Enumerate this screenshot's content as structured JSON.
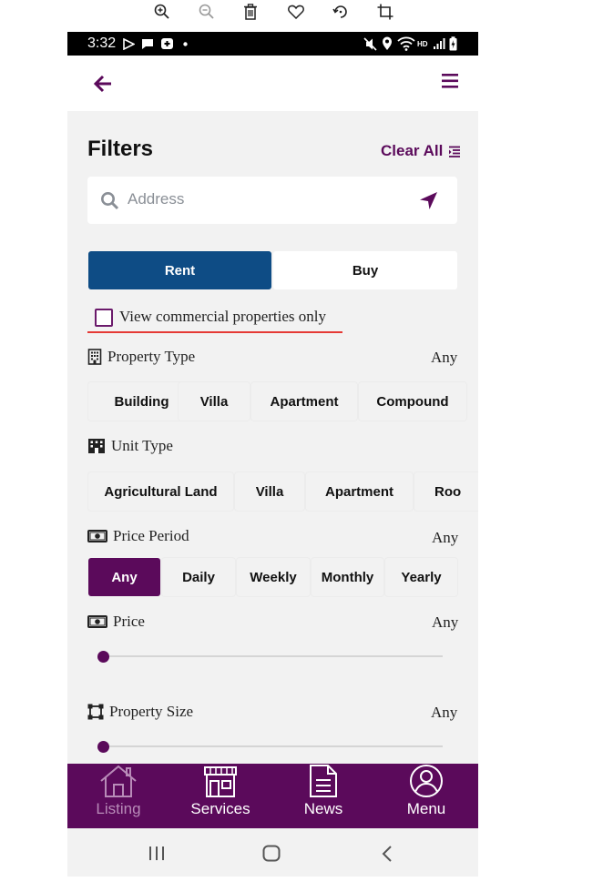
{
  "viewer_toolbar": {
    "icons": [
      "zoom-in-icon",
      "zoom-out-icon",
      "trash-icon",
      "heart-icon",
      "rotate-icon",
      "crop-icon"
    ]
  },
  "status_bar": {
    "time": "3:32"
  },
  "filters": {
    "title": "Filters",
    "clear_all": "Clear All",
    "search_placeholder": "Address",
    "listing_mode": {
      "rent": "Rent",
      "buy": "Buy",
      "selected": "Rent"
    },
    "commercial_only": {
      "label": "View commercial properties only",
      "checked": false
    },
    "property_type": {
      "label": "Property Type",
      "value": "Any",
      "options": [
        "Building",
        "Villa",
        "Apartment",
        "Compound"
      ]
    },
    "unit_type": {
      "label": "Unit Type",
      "options": [
        "Agricultural Land",
        "Villa",
        "Apartment",
        "Roo"
      ]
    },
    "price_period": {
      "label": "Price Period",
      "value": "Any",
      "options": [
        "Any",
        "Daily",
        "Weekly",
        "Monthly",
        "Yearly"
      ],
      "selected": "Any"
    },
    "price": {
      "label": "Price",
      "value": "Any",
      "slider_fraction": 0
    },
    "property_size": {
      "label": "Property Size",
      "value": "Any",
      "slider_fraction": 0
    }
  },
  "bottom_nav": {
    "items": [
      {
        "label": "Listing",
        "icon": "house-icon",
        "enabled": false
      },
      {
        "label": "Services",
        "icon": "storefront-icon",
        "enabled": true
      },
      {
        "label": "News",
        "icon": "document-icon",
        "enabled": true
      },
      {
        "label": "Menu",
        "icon": "user-circle-icon",
        "enabled": true
      }
    ]
  },
  "colors": {
    "brand": "#5b0a5b",
    "rent_selected": "#0e4c85",
    "underline": "#e53935"
  }
}
